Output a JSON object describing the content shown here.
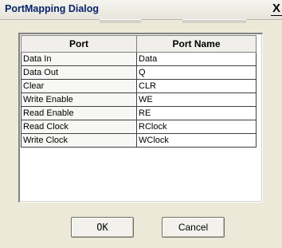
{
  "window": {
    "title": "PortMapping Dialog",
    "close_glyph": "X"
  },
  "table": {
    "headers": [
      "Port",
      "Port Name"
    ],
    "rows": [
      [
        "Data In",
        "Data"
      ],
      [
        "Data Out",
        "Q"
      ],
      [
        "Clear",
        "CLR"
      ],
      [
        "Write Enable",
        "WE"
      ],
      [
        "Read Enable",
        "RE"
      ],
      [
        "Read Clock",
        "RClock"
      ],
      [
        "Write Clock",
        "WClock"
      ]
    ]
  },
  "buttons": {
    "ok": "OK",
    "cancel": "Cancel"
  }
}
